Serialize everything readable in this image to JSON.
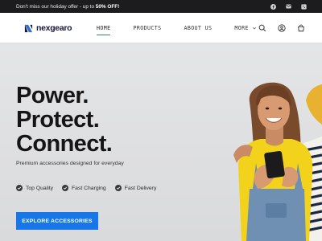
{
  "announcement": {
    "text_prefix": "Don't miss our holiday offer - up to ",
    "text_highlight": "50% OFF!",
    "socials": [
      "facebook-icon",
      "email-icon",
      "phone-icon"
    ]
  },
  "header": {
    "logo_text": "nexgearo",
    "nav": [
      {
        "label": "HOME",
        "active": true
      },
      {
        "label": "PRODUCTS",
        "active": false
      },
      {
        "label": "ABOUT US",
        "active": false
      },
      {
        "label": "MORE",
        "active": false,
        "has_dropdown": true
      }
    ],
    "icons": [
      "search-icon",
      "user-icon",
      "cart-icon"
    ]
  },
  "hero": {
    "headline": [
      "Power.",
      "Protect.",
      "Connect."
    ],
    "subtitle": "Premium accessories designed for everyday",
    "features": [
      "Top Quality",
      "Fast Charging",
      "Fast Delivery"
    ],
    "cta_label": "EXPLORE ACCESSORIES"
  },
  "colors": {
    "accent": "#1877e8",
    "nav_active_underline": "#2f6fd6",
    "topbar_bg": "#1c1c1f",
    "hero_bg": "#dfe0e2"
  }
}
